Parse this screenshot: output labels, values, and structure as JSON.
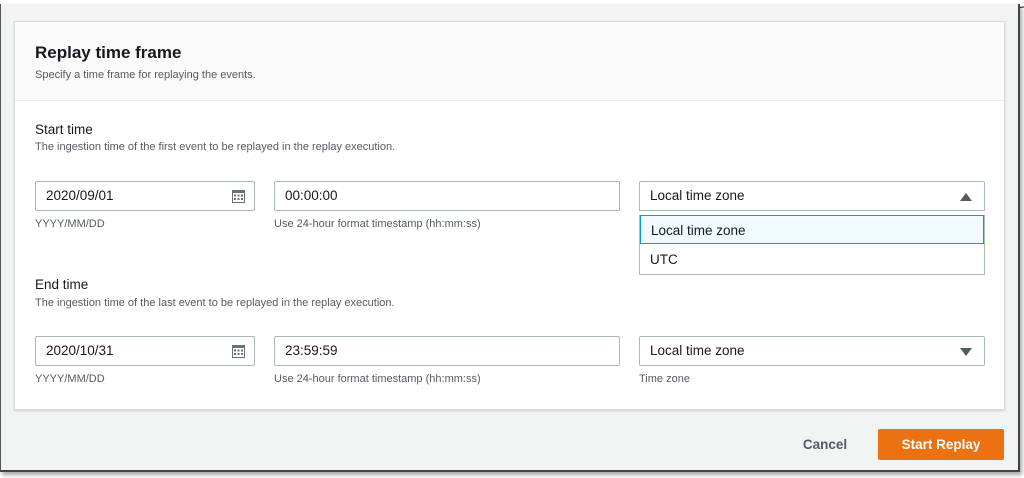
{
  "panel": {
    "title": "Replay time frame",
    "description": "Specify a time frame for replaying the events."
  },
  "start": {
    "label": "Start time",
    "description": "The ingestion time of the first event to be replayed in the replay execution.",
    "date_value": "2020/09/01",
    "date_hint": "YYYY/MM/DD",
    "time_value": "00:00:00",
    "time_hint": "Use 24-hour format timestamp (hh:mm:ss)",
    "timezone_value": "Local time zone",
    "timezone_options": [
      "Local time zone",
      "UTC"
    ]
  },
  "end": {
    "label": "End time",
    "description": "The ingestion time of the last event to be replayed in the replay execution.",
    "date_value": "2020/10/31",
    "date_hint": "YYYY/MM/DD",
    "time_value": "23:59:59",
    "time_hint": "Use 24-hour format timestamp (hh:mm:ss)",
    "timezone_value": "Local time zone",
    "timezone_hint": "Time zone"
  },
  "footer": {
    "cancel_label": "Cancel",
    "primary_label": "Start Replay"
  },
  "icons": {
    "date": "calendar-icon",
    "dropdown_open": "caret-up-icon",
    "dropdown_closed": "caret-down-icon"
  },
  "colors": {
    "primary": "#ec7211",
    "selected_bg": "#f1faff",
    "focus_border": "#00a1c9"
  }
}
